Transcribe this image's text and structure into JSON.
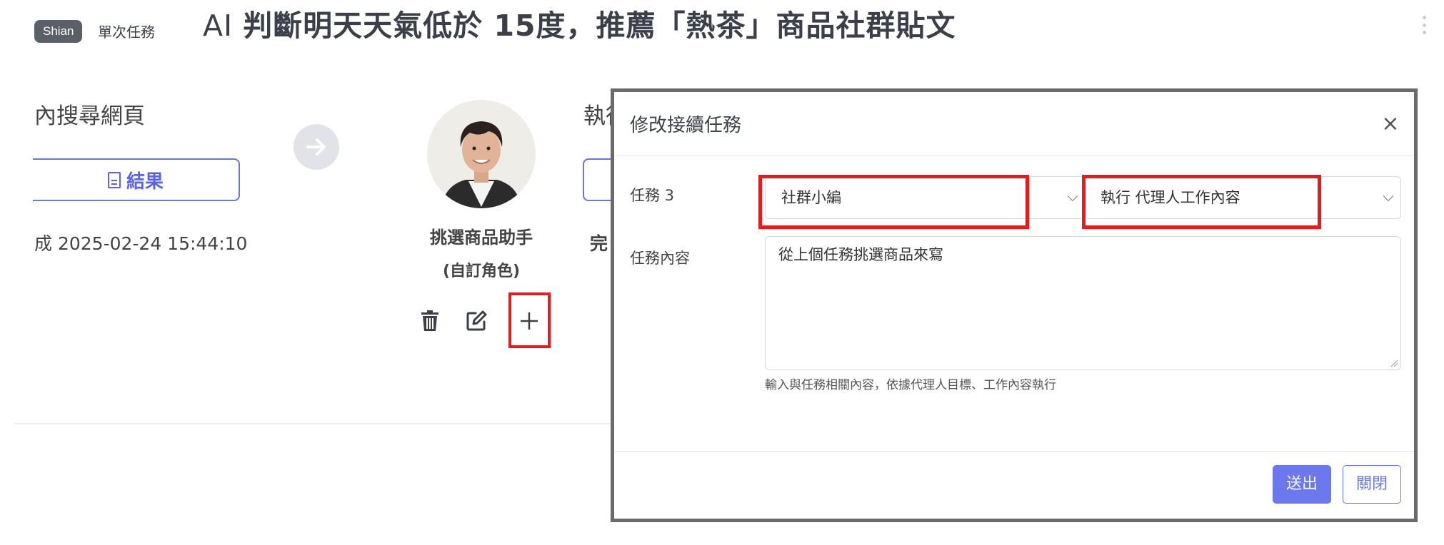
{
  "header": {
    "user_badge": "Shian",
    "task_type": "單次任務",
    "title_prefix": "AI",
    "title_rest": "判斷明天天氣低於 15度，推薦「熱茶」商品社群貼文"
  },
  "flow": {
    "step1": {
      "title": "內搜尋網頁",
      "result_button": "結果",
      "completed_text": "成 2025-02-24 15:44:10"
    },
    "agent": {
      "name": "挑選商品助手",
      "role": "(自訂角色)"
    },
    "step2": {
      "title_fragment": "執行",
      "done_fragment": "完"
    }
  },
  "modal": {
    "title": "修改接續任務",
    "task_label": "任務 3",
    "role_select": "社群小編",
    "action_select": "執行 代理人工作內容",
    "content_label": "任務內容",
    "content_value": "從上個任務挑選商品來寫",
    "helper_text": "輸入與任務相關內容，依據代理人目標、工作內容執行",
    "submit_label": "送出",
    "close_label": "關閉"
  },
  "colors": {
    "accent": "#6b78ee",
    "highlight": "#e31d1d",
    "badge": "#5b5f68"
  }
}
